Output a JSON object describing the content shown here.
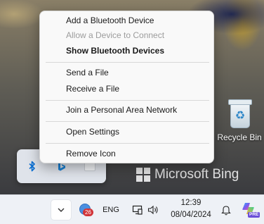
{
  "desktop": {
    "watermark": "Microsoft Bing",
    "recycle_bin_label": "Recycle Bin"
  },
  "tray_flyout": {
    "icons": [
      "bluetooth-icon",
      "bing-b-icon",
      "blank-app-icon"
    ]
  },
  "context_menu": {
    "items": [
      {
        "label": "Add a Bluetooth Device",
        "state": "normal"
      },
      {
        "label": "Allow a Device to Connect",
        "state": "disabled"
      },
      {
        "label": "Show Bluetooth Devices",
        "state": "default-bold"
      },
      {
        "label": "Send a File",
        "state": "normal"
      },
      {
        "label": "Receive a File",
        "state": "normal"
      },
      {
        "label": "Join a Personal Area Network",
        "state": "normal"
      },
      {
        "label": "Open Settings",
        "state": "normal"
      },
      {
        "label": "Remove Icon",
        "state": "normal"
      }
    ]
  },
  "taskbar": {
    "overflow_icon": "chevron-down-icon",
    "notification_badge": "26",
    "language": "ENG",
    "time": "12:39",
    "date": "08/04/2024",
    "copilot_badge": "PRE"
  },
  "colors": {
    "bluetooth_blue": "#0a6ed1",
    "badge_red": "#d13438",
    "taskbar_bg": "#eef1f6",
    "menu_bg": "#f9f9f9"
  }
}
